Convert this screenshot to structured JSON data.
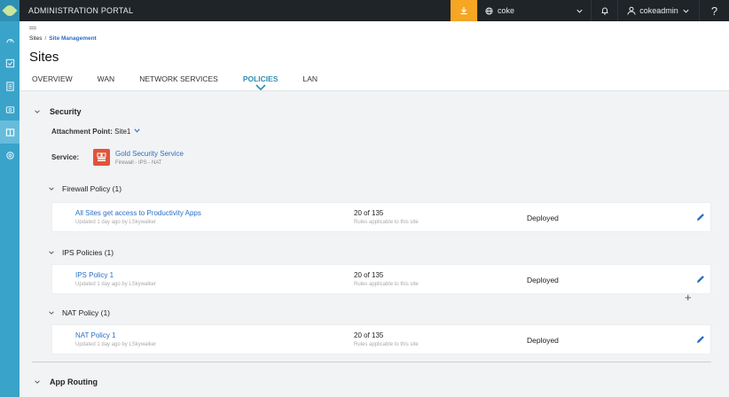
{
  "topbar": {
    "title": "ADMINISTRATION PORTAL",
    "tenant": "coke",
    "user": "cokeadmin",
    "help": "?"
  },
  "breadcrumb": {
    "root": "Sites",
    "separator": "/",
    "current": "Site Management"
  },
  "page_title": "Sites",
  "tabs": [
    {
      "label": "OVERVIEW"
    },
    {
      "label": "WAN"
    },
    {
      "label": "NETWORK SERVICES"
    },
    {
      "label": "POLICIES",
      "active": true
    },
    {
      "label": "LAN"
    }
  ],
  "security": {
    "heading": "Security",
    "attachment_label": "Attachment Point:",
    "attachment_value": "Site1",
    "service_label": "Service:",
    "service_name": "Gold Security Service",
    "service_sub": "Firewall - IPS - NAT",
    "policies": [
      {
        "heading": "Firewall Policy (1)",
        "name": "All Sites get access to Productivity Apps",
        "updated": "Updated 1 day ago by LSkywalker",
        "count": "20 of 135",
        "rules": "Rules applicable to this site",
        "status": "Deployed"
      },
      {
        "heading": "IPS Policies (1)",
        "name": "IPS Policy 1",
        "updated": "Updated 1 day ago by LSkywalker",
        "count": "20 of 135",
        "rules": "Rules applicable to this site",
        "status": "Deployed"
      },
      {
        "heading": "NAT Policy (1)",
        "name": "NAT Policy 1",
        "updated": "Updated 1 day ago by LSkywalker",
        "count": "20 of 135",
        "rules": "Rules applicable to this site",
        "status": "Deployed"
      }
    ]
  },
  "app_routing": {
    "heading": "App Routing"
  },
  "plus_symbol": "+",
  "colors": {
    "accent": "#3aa3c9",
    "topbar": "#1f2429",
    "alert": "#f5a623",
    "link": "#2b6fc2",
    "service_icon": "#e2533a"
  },
  "icons": {
    "rail": [
      "logo-icon",
      "dashboard-icon",
      "monitor-icon",
      "document-icon",
      "configure-icon",
      "sites-icon",
      "settings-icon"
    ],
    "topbar": [
      "alert-icon",
      "globe-icon",
      "bell-icon",
      "user-icon"
    ],
    "edit": "pencil-icon"
  }
}
